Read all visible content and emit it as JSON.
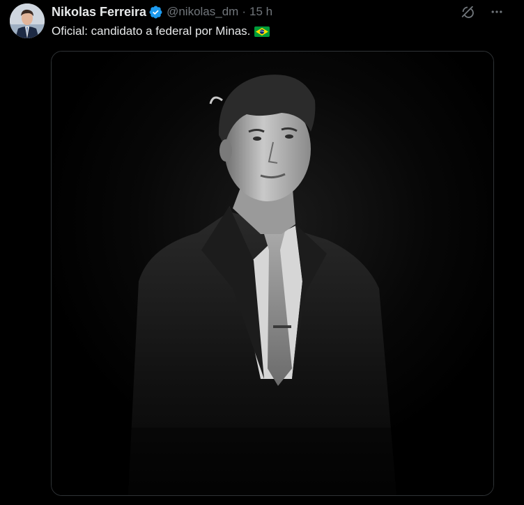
{
  "tweet": {
    "author_name": "Nikolas Ferreira",
    "handle": "@nikolas_dm",
    "separator": "·",
    "time": "15 h",
    "text": "Oficial: candidato a federal por Minas.",
    "emoji": "brazil-flag",
    "verified": true
  },
  "actions": {
    "grok_icon": "grok-icon",
    "more_icon": "more-icon"
  },
  "media": {
    "type": "photo",
    "description_icon": "portrait-photo"
  },
  "colors": {
    "background": "#000000",
    "text_primary": "#e7e9ea",
    "text_secondary": "#71767b",
    "verified": "#1d9bf0",
    "border": "#2f3336"
  }
}
